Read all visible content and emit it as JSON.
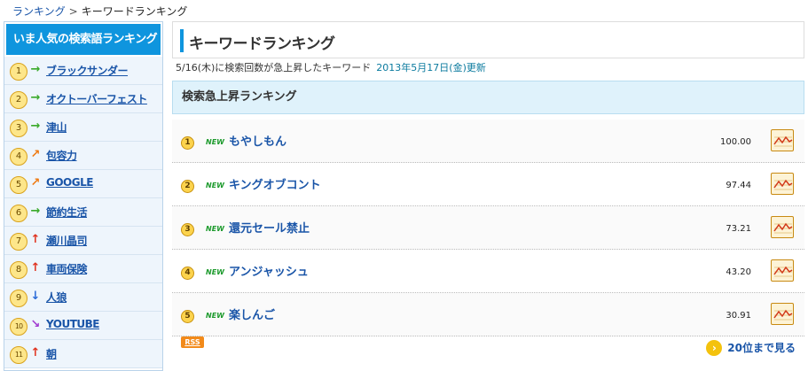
{
  "breadcrumb": {
    "home_label": "ランキング",
    "separator": ">",
    "current": "キーワードランキング"
  },
  "sidebar": {
    "title": "いま人気の検索語ランキング",
    "items": [
      {
        "rank": "1",
        "trend": "right",
        "label": "ブラックサンダー"
      },
      {
        "rank": "2",
        "trend": "right",
        "label": "オクトーバーフェスト"
      },
      {
        "rank": "3",
        "trend": "right",
        "label": "津山"
      },
      {
        "rank": "4",
        "trend": "diagup",
        "label": "包容力"
      },
      {
        "rank": "5",
        "trend": "diagup",
        "label": "GOOGLE"
      },
      {
        "rank": "6",
        "trend": "right",
        "label": "節約生活"
      },
      {
        "rank": "7",
        "trend": "up",
        "label": "瀬川晶司"
      },
      {
        "rank": "8",
        "trend": "up",
        "label": "車両保険"
      },
      {
        "rank": "9",
        "trend": "down",
        "label": "人狼"
      },
      {
        "rank": "10",
        "trend": "diagdown",
        "label": "YOUTUBE"
      },
      {
        "rank": "11",
        "trend": "up",
        "label": "朝"
      }
    ]
  },
  "main": {
    "title": "キーワードランキング",
    "info_text": "5/16(木)に検索回数が急上昇したキーワード",
    "updated": "2013年5月17日(金)更新",
    "section_title": "検索急上昇ランキング",
    "new_badge": "NEW",
    "rows": [
      {
        "rank": "1",
        "keyword": "もやしもん",
        "score": "100.00"
      },
      {
        "rank": "2",
        "keyword": "キングオブコント",
        "score": "97.44"
      },
      {
        "rank": "3",
        "keyword": "還元セール禁止",
        "score": "73.21"
      },
      {
        "rank": "4",
        "keyword": "アンジャッシュ",
        "score": "43.20"
      },
      {
        "rank": "5",
        "keyword": "楽しんご",
        "score": "30.91"
      }
    ],
    "rss_label": "RSS",
    "more_label": "20位まで見る",
    "more_icon": "chevron-right-icon"
  },
  "icons": {
    "trend_right": "→",
    "trend_up": "↑",
    "trend_down": "↓",
    "trend_diagup": "↗",
    "trend_diagdown": "↘"
  },
  "colors": {
    "accent": "#0f95de",
    "link": "#1a55a8",
    "new_badge": "#1c9a2c",
    "rss": "#f28a1a"
  }
}
